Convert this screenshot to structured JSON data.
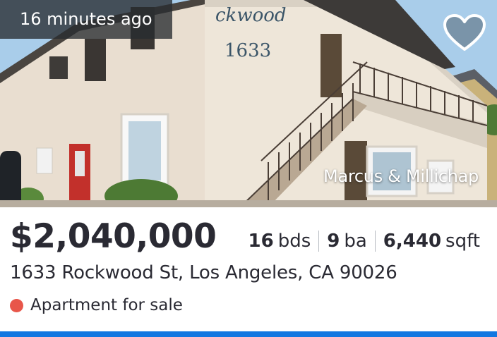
{
  "listing": {
    "time_ago": "16 minutes ago",
    "brokerage": "Marcus & Millichap",
    "price": "$2,040,000",
    "beds": "16",
    "beds_unit": "bds",
    "baths": "9",
    "baths_unit": "ba",
    "sqft": "6,440",
    "sqft_unit": "sqft",
    "address": "1633 Rockwood St, Los Angeles, CA 90026",
    "status": "Apartment for sale",
    "photo_sign_name": "ckwood",
    "photo_sign_number": "1633"
  },
  "icons": {
    "favorite": "heart-outline-icon",
    "status": "red-dot-icon"
  },
  "colors": {
    "status_dot": "#e8564a",
    "accent_bar": "#1277e1"
  }
}
